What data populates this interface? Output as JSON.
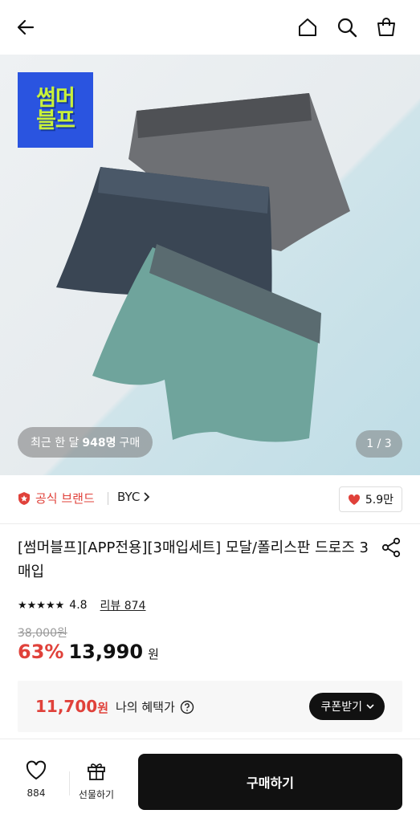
{
  "hero": {
    "badge_line1": "썸머",
    "badge_line2": "블프",
    "buyers_prefix": "최근 한 달",
    "buyers_count": "948명",
    "buyers_suffix": "구매",
    "page_indicator": "1 / 3"
  },
  "brand": {
    "official_label": "공식 브랜드",
    "name": "BYC",
    "likes": "5.9만"
  },
  "product": {
    "title": "[썸머블프][APP전용][3매입세트] 모달/폴리스판 드로즈 3매입",
    "rating": "4.8",
    "reviews": "리뷰 874",
    "original_price": "38,000원",
    "discount": "63%",
    "price": "13,990",
    "currency": "원"
  },
  "benefit": {
    "price": "11,700",
    "currency": "원",
    "label": "나의 혜택가",
    "coupon_button": "쿠폰받기"
  },
  "bottom_bar": {
    "wish_count": "884",
    "gift_label": "선물하기",
    "buy_label": "구매하기"
  },
  "colors": {
    "accent_red": "#e0413a",
    "badge_blue": "#2a54e0",
    "badge_lime": "#c9f13a",
    "boxer_gray": "#6e7074",
    "boxer_navy": "#3a4654",
    "boxer_mint": "#6fa49c"
  }
}
